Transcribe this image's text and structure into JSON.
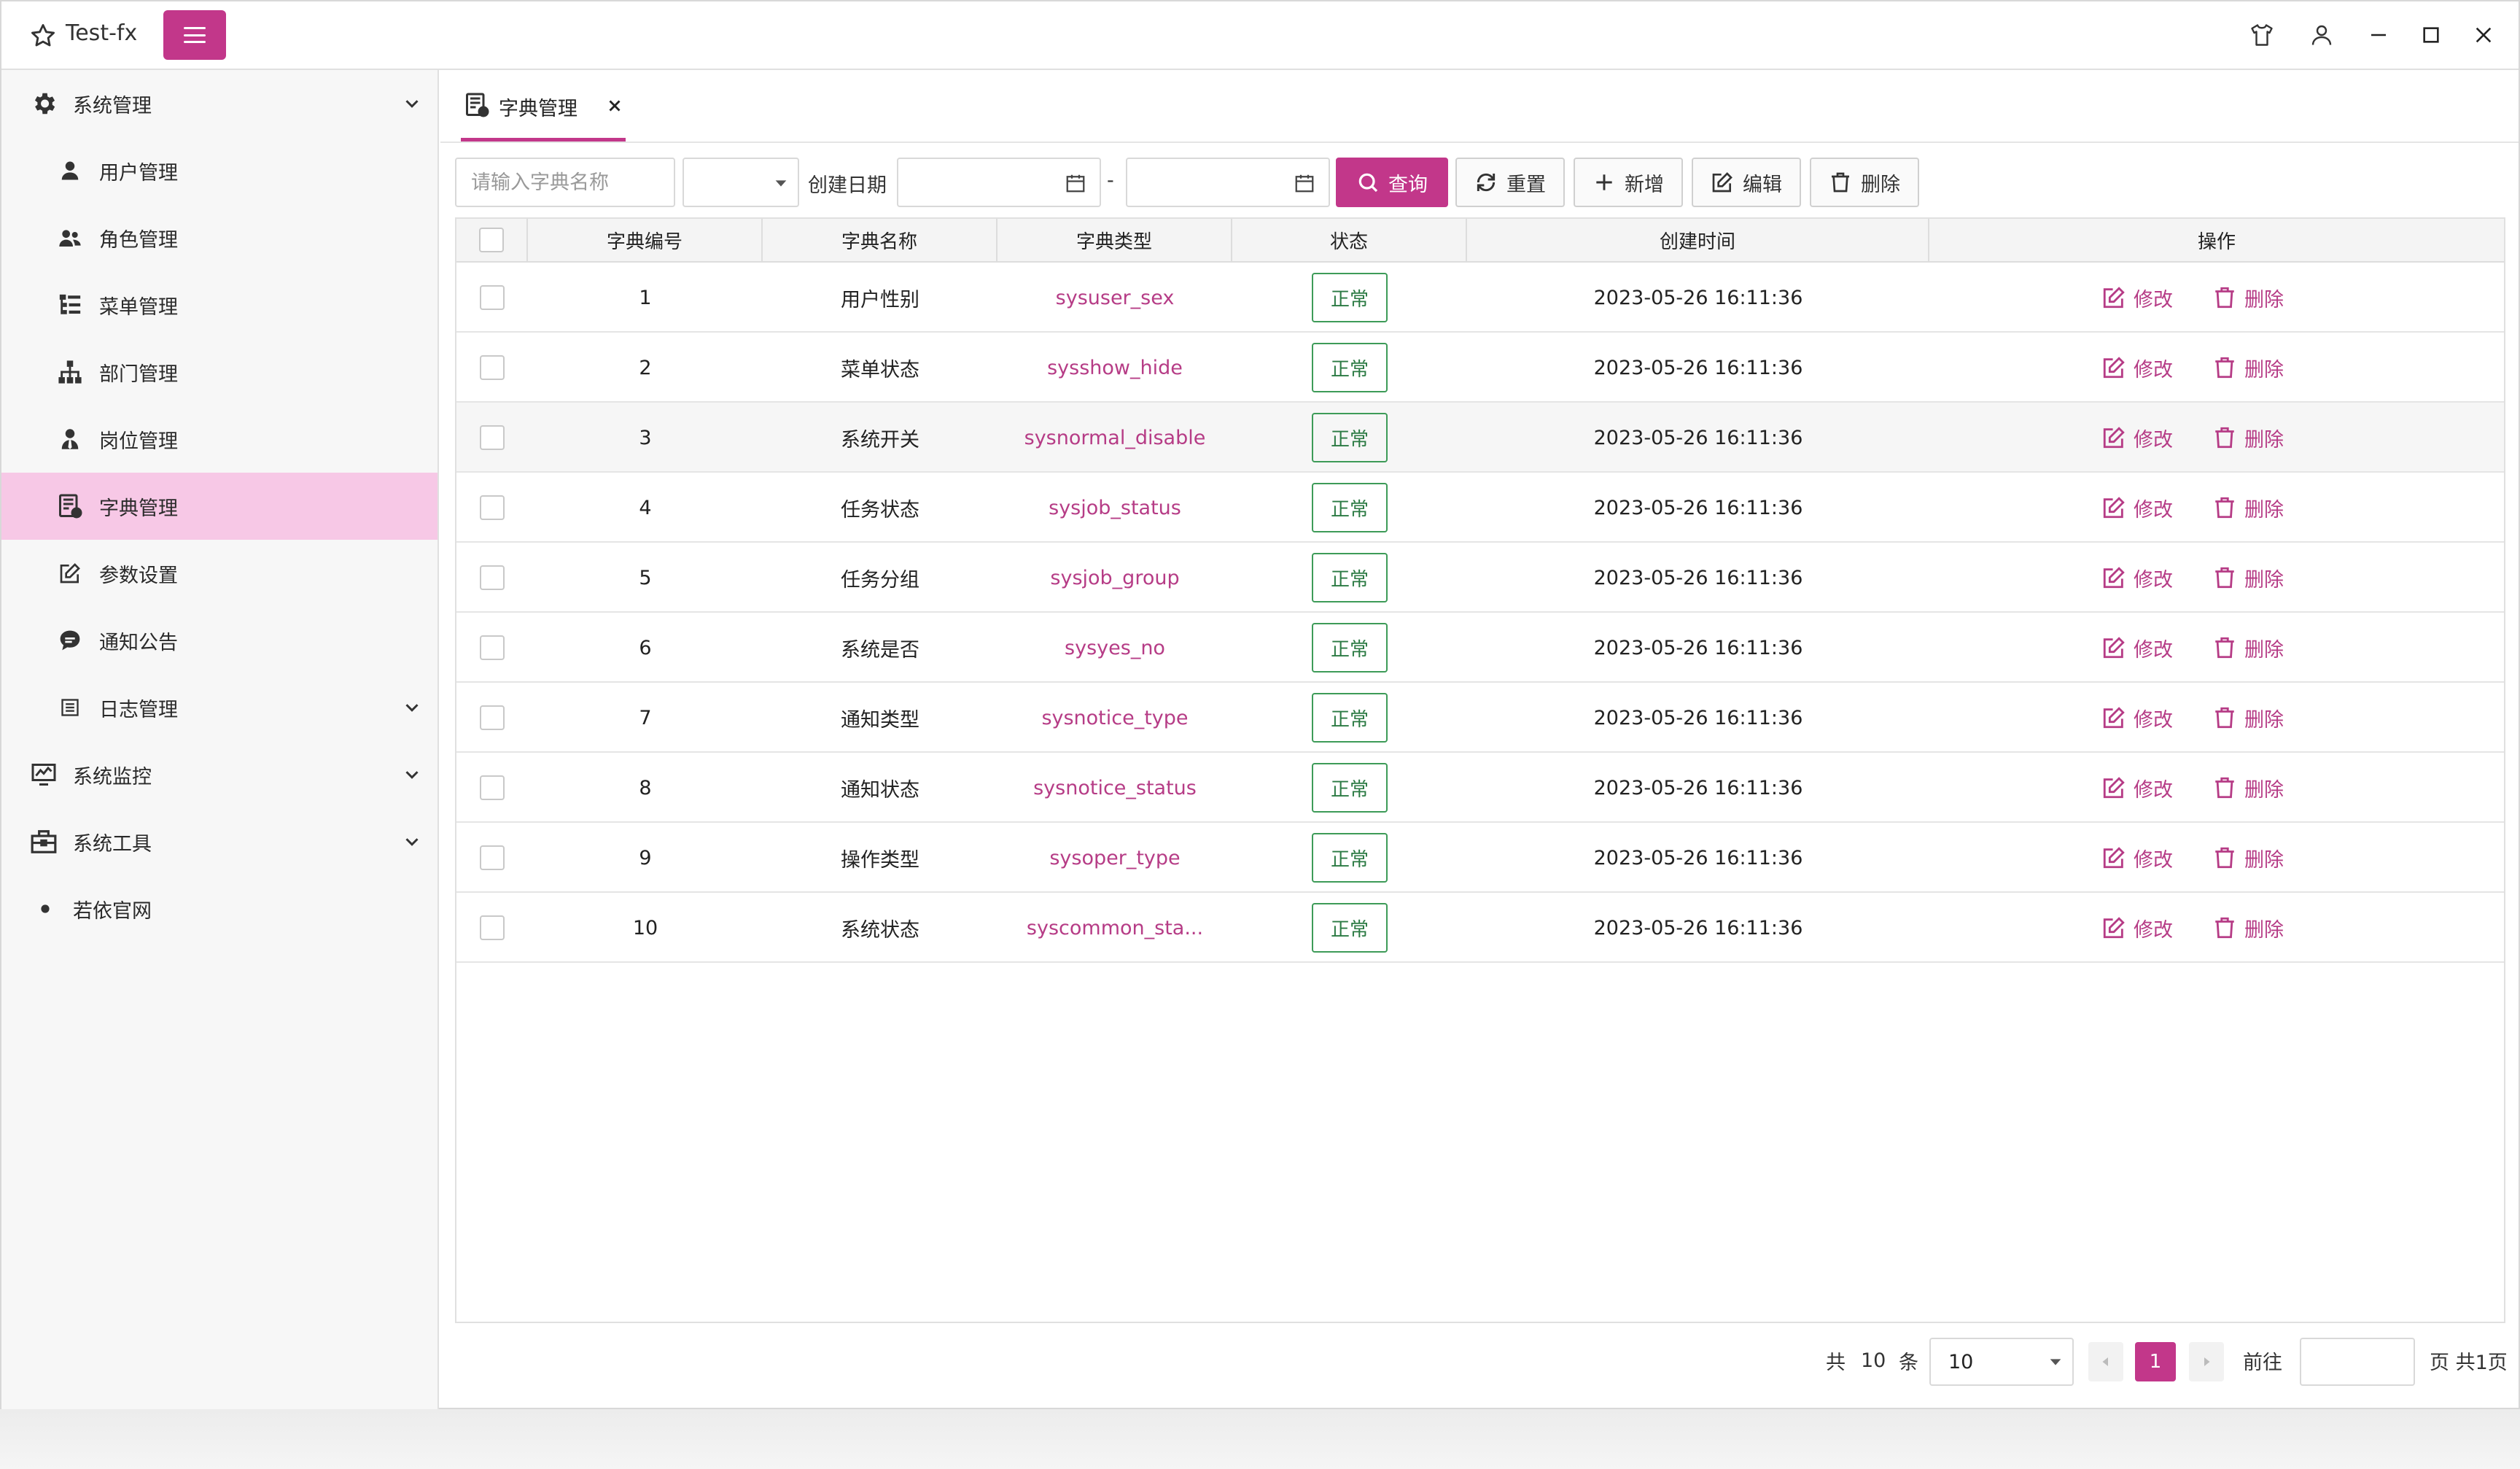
{
  "app": {
    "title": "Test-fx"
  },
  "colors": {
    "accent": "#c2378a",
    "active_bg": "#f7c8e6",
    "status_border": "#3d9b58"
  },
  "sidebar": {
    "items": [
      {
        "label": "系统管理",
        "icon": "gear-icon",
        "level": 1,
        "expandable": true
      },
      {
        "label": "用户管理",
        "icon": "user-icon",
        "level": 2
      },
      {
        "label": "角色管理",
        "icon": "users-icon",
        "level": 2
      },
      {
        "label": "菜单管理",
        "icon": "tree-list-icon",
        "level": 2
      },
      {
        "label": "部门管理",
        "icon": "sitemap-icon",
        "level": 2
      },
      {
        "label": "岗位管理",
        "icon": "user-tie-icon",
        "level": 2
      },
      {
        "label": "字典管理",
        "icon": "dictionary-icon",
        "level": 2,
        "active": true
      },
      {
        "label": "参数设置",
        "icon": "edit-icon",
        "level": 2
      },
      {
        "label": "通知公告",
        "icon": "comment-icon",
        "level": 2
      },
      {
        "label": "日志管理",
        "icon": "log-icon",
        "level": 2,
        "expandable": true
      },
      {
        "label": "系统监控",
        "icon": "monitor-icon",
        "level": 1,
        "expandable": true
      },
      {
        "label": "系统工具",
        "icon": "toolbox-icon",
        "level": 1,
        "expandable": true
      },
      {
        "label": "若依官网",
        "icon": "dot-icon",
        "level": 1
      }
    ]
  },
  "tabs": [
    {
      "label": "字典管理"
    }
  ],
  "search": {
    "name_placeholder": "请输入字典名称",
    "status_value": "",
    "date_label": "创建日期",
    "date_sep": "-",
    "buttons": {
      "query": "查询",
      "reset": "重置",
      "add": "新增",
      "edit": "编辑",
      "delete": "删除"
    }
  },
  "table": {
    "headers": [
      "字典编号",
      "字典名称",
      "字典类型",
      "状态",
      "创建时间",
      "操作"
    ],
    "rows": [
      {
        "id": "1",
        "name": "用户性别",
        "type": "sysuser_sex",
        "status": "正常",
        "created": "2023-05-26 16:11:36"
      },
      {
        "id": "2",
        "name": "菜单状态",
        "type": "sysshow_hide",
        "status": "正常",
        "created": "2023-05-26 16:11:36"
      },
      {
        "id": "3",
        "name": "系统开关",
        "type": "sysnormal_disable",
        "status": "正常",
        "created": "2023-05-26 16:11:36"
      },
      {
        "id": "4",
        "name": "任务状态",
        "type": "sysjob_status",
        "status": "正常",
        "created": "2023-05-26 16:11:36"
      },
      {
        "id": "5",
        "name": "任务分组",
        "type": "sysjob_group",
        "status": "正常",
        "created": "2023-05-26 16:11:36"
      },
      {
        "id": "6",
        "name": "系统是否",
        "type": "sysyes_no",
        "status": "正常",
        "created": "2023-05-26 16:11:36"
      },
      {
        "id": "7",
        "name": "通知类型",
        "type": "sysnotice_type",
        "status": "正常",
        "created": "2023-05-26 16:11:36"
      },
      {
        "id": "8",
        "name": "通知状态",
        "type": "sysnotice_status",
        "status": "正常",
        "created": "2023-05-26 16:11:36"
      },
      {
        "id": "9",
        "name": "操作类型",
        "type": "sysoper_type",
        "status": "正常",
        "created": "2023-05-26 16:11:36"
      },
      {
        "id": "10",
        "name": "系统状态",
        "type": "syscommon_sta...",
        "status": "正常",
        "created": "2023-05-26 16:11:36"
      }
    ],
    "actions": {
      "edit": "修改",
      "delete": "删除"
    }
  },
  "pagination": {
    "total_prefix": "共",
    "total": "10",
    "total_suffix": "条",
    "page_size": "10",
    "current_page": "1",
    "goto_label": "前往",
    "goto_value": "",
    "pages_suffix": "页 共1页"
  }
}
